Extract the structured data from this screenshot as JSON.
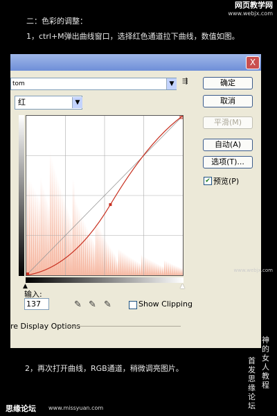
{
  "brand": {
    "name": "网页教学网",
    "url": "www.webjx.com"
  },
  "captions": {
    "section": "二：色彩的调整：",
    "step1": "1，ctrl+M弹出曲线窗口，选择红色通道拉下曲线，数值如图。",
    "step2": "2，再次打开曲线，RGB通道，稍微调亮图片。"
  },
  "watermark_mid": "www.webjx.com",
  "dialog": {
    "close_glyph": "X",
    "preset_value": "tom",
    "preset_menu_glyph": "⇶",
    "channel_value": "红",
    "buttons": {
      "ok": "确定",
      "cancel": "取消",
      "smooth": "平滑(M)",
      "auto": "自动(A)",
      "options": "选项(T)..."
    },
    "preview_label": "预览(P)",
    "preview_checked": true,
    "input_label": "输入:",
    "input_value": "137",
    "show_clipping_label": "Show Clipping",
    "display_options_label": "re Display Options",
    "curve_point": {
      "input": 137,
      "output": 113
    },
    "channel_color": "#c83020",
    "histogram_color": "#f6b9a3"
  },
  "side_text_1": [
    "神",
    "的",
    "女",
    "人",
    "教",
    "程"
  ],
  "side_text_2": [
    "首",
    "发",
    "思",
    "缘",
    "论",
    "坛"
  ],
  "footer": {
    "forum": "思缘论坛",
    "url": "www.missyuan.com"
  }
}
